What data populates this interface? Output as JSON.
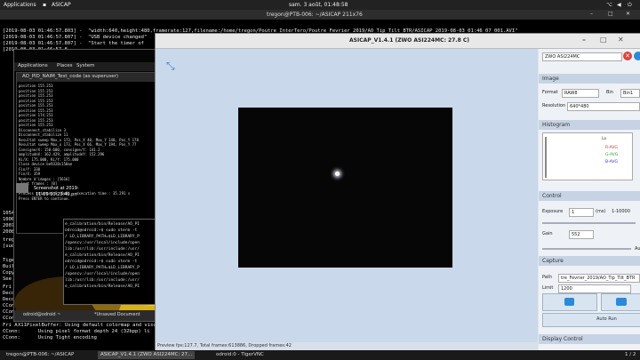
{
  "topbar": {
    "applications": "Applications",
    "app_name": "ASICAP",
    "clock": "sam. 3 août, 01:48:58"
  },
  "terminal": {
    "title": "tregon@PTB-006: ~/ASICAP 211x76",
    "lines": [
      "[2019-08-03 01:46:57.803] -  \"width:640,height:480,framerate:127,filename:/home/tregon/Poutre InterTero/Poutre Fevrier 2019/AO_Tip_Tilt_BTR/ASICAP 2019-08-03 01:46 07 001.AVI\"",
      "[2019-08-03 01:46:57.807] -  \"USB device changed\"",
      "[2019-08-03 01:46:57.807] -  \"Start the timer of",
      "[2019-08-03 01:46:57.8"
    ],
    "bottom_lines": [
      "X11PixelBuffer: Using default colormap and visual,",
      "CConn:      Using pixel format depth 24 (32bpp) li",
      "CConn:      Using Tight encoding"
    ],
    "left_fragments": [
      "1054",
      "1000",
      "2007",
      "2008",
      "tregon",
      "[sudo]",
      "Tiger",
      "Built",
      "Copy",
      "See h",
      "Fri A",
      "Deco",
      "Deco",
      "CConn",
      "CConn",
      "CConn",
      "CConn",
      "Fri A"
    ]
  },
  "vnc": {
    "menubar": [
      "Applications",
      "Places",
      "System"
    ],
    "inner_title": "AO_PID_NAIM_Test_code (as superuser)",
    "inner_lines": [
      "position 155.253",
      "position 155.253",
      "position 155.253",
      "position 155.253",
      "position 155.253",
      "position 155.253",
      "position 174.253",
      "position 155.253",
      "position 155.253",
      "Disconnect_stabilize 3",
      "Disconnect_stabilize 11",
      "Resultat sweep Max_x 173, Pos_X 40, Max_Y 140, Pos_Y 178",
      "Resultat sweep Max_x 173, Pos_X 66, Max_Y 194, Pos_Y 77",
      "Consigne/X: 150.600, consigne/Y: 141.2",
      "amplitudeX: 162.429, amplitudeY: 152.296",
      "Ki/X: 175.000, Ki/Y: 175.000",
      "Close device be9328c150ae",
      "Fin/Y: 330",
      "Fin/X: 359",
      "Nombre d'images : [5616]",
      " lost frames : [0]",
      "",
      "Process returned 0 (0x0)   execution time : 35.291 s",
      "Press ENTER to continue."
    ],
    "screenshot_label": "Screenshot at 2019-",
    "screenshot_time": "11-09 10:23:49.pn",
    "xterm_lines": [
      "e_calibration/bin/Release/AO_PI",
      "odroid@odroid:~$ sudo xterm -t",
      "/ LD_LIBRARY_PATH=$LD_LIBRARY_P",
      "/opencv:/usr/local/include/open",
      "lib:/usr/lib:/usr/include:/usr/",
      "e_calibration/bin/Release/AO_PI",
      "odroid@odroid:~$ sudo xterm -t",
      "/ LD_LIBRARY_PATH=$LD_LIBRARY_P",
      "/opencv:/usr/local/include/open",
      "lib:/usr/lib:/usr/include:/usr/",
      "e_calibration/bin/Release/AO_PI"
    ],
    "taskbar_left": "odroid@odroid ~",
    "taskbar_right": "*Unsaved Document"
  },
  "asicap": {
    "title": "ASICAP_V1.4.1 (ZWO ASI224MC: 27.8 C)",
    "camera": "ZWO ASI224MC",
    "image": {
      "header": "Image",
      "format_label": "Format",
      "format_value": "RAW8",
      "bin_label": "Bin",
      "bin_value": "Bin1",
      "resolution_label": "Resolution",
      "resolution_value": "640*480"
    },
    "histogram": {
      "header": "Histogram",
      "legend": [
        "Lo",
        "R-AVG",
        "G-AVG",
        "B-AVG"
      ]
    },
    "control": {
      "header": "Control",
      "exposure_label": "Exposure",
      "exposure_value": "1",
      "exposure_unit": "(ms)",
      "exposure_extra": "1-10000",
      "gain_label": "Gain",
      "gain_value": "552",
      "auto_label": "Au"
    },
    "capture": {
      "header": "Capture",
      "path_label": "Path",
      "path_value": "tre_Fevrier_2019/AO_Tip_Tilt_BTR",
      "limit_label": "Limit",
      "limit_value": "1200",
      "auto_run": "Auto Run"
    },
    "display_control": {
      "header": "Display Control"
    },
    "status": "Preview fps:127.7, Total frames:613886, Dropped frames:42"
  },
  "taskbar": {
    "items": [
      "tregon@PTB-006: ~/ASICAP",
      "ASICAP_V1.4.1 (ZWO ASI224MC: 27...",
      "odroid:0 - TigerVNC"
    ],
    "pager": "1 / 2"
  },
  "colors": {
    "preview_bg": "#c9d8ea",
    "close_red": "#d9443c",
    "accent_blue": "#2b8ad8"
  }
}
